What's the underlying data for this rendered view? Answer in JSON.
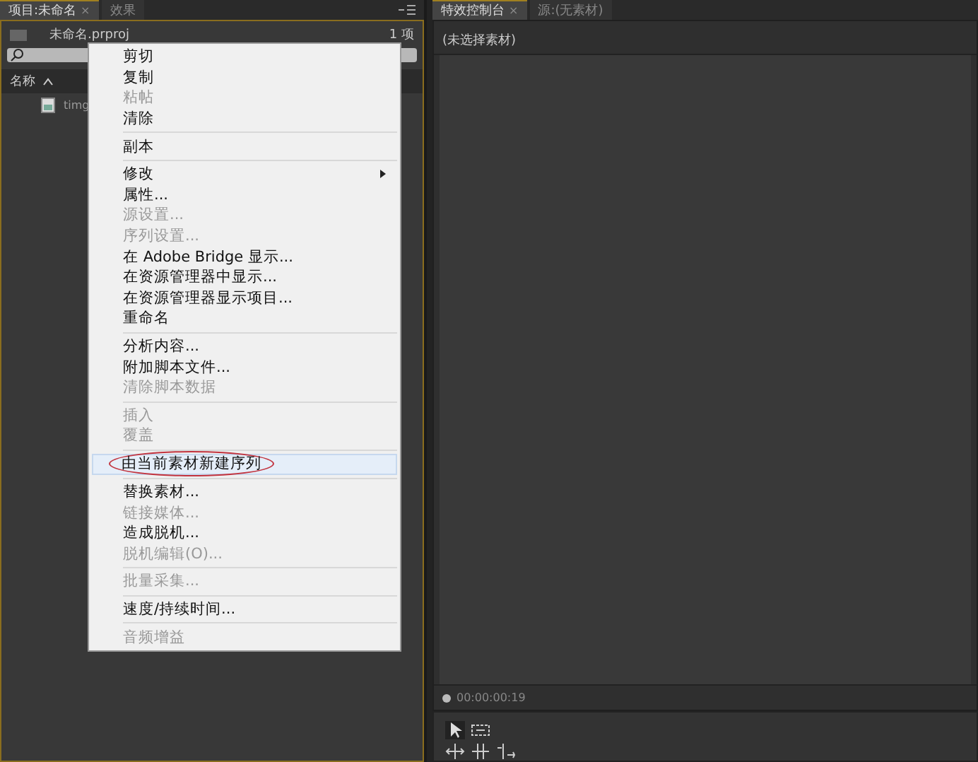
{
  "project_panel": {
    "tabs": [
      {
        "label": "项目:未命名",
        "close_glyph": "×",
        "selected": true
      },
      {
        "label": "效果",
        "selected": false
      }
    ],
    "file_name": "未命名.prproj",
    "item_count": "1 项",
    "column": "名称",
    "files": [
      {
        "name": "timg"
      }
    ]
  },
  "context_menu": {
    "groups": [
      {
        "items": [
          {
            "label": "剪切",
            "disabled": false
          },
          {
            "label": "复制",
            "disabled": false
          },
          {
            "label": "粘帖",
            "disabled": true
          },
          {
            "label": "清除",
            "disabled": false
          }
        ]
      },
      {
        "items": [
          {
            "label": "副本",
            "disabled": false
          }
        ]
      },
      {
        "items": [
          {
            "label": "修改",
            "disabled": false,
            "submenu": true
          },
          {
            "label": "属性...",
            "disabled": false
          },
          {
            "label": "源设置...",
            "disabled": true
          },
          {
            "label": "序列设置...",
            "disabled": true
          },
          {
            "label": "在 Adobe Bridge 显示...",
            "disabled": false
          },
          {
            "label": "在资源管理器中显示...",
            "disabled": false
          },
          {
            "label": "在资源管理器显示项目...",
            "disabled": false
          },
          {
            "label": "重命名",
            "disabled": false
          }
        ]
      },
      {
        "items": [
          {
            "label": "分析内容...",
            "disabled": false
          },
          {
            "label": "附加脚本文件...",
            "disabled": false
          },
          {
            "label": "清除脚本数据",
            "disabled": true
          }
        ]
      },
      {
        "items": [
          {
            "label": "插入",
            "disabled": true
          },
          {
            "label": "覆盖",
            "disabled": true
          }
        ]
      },
      {
        "items": [
          {
            "label": "由当前素材新建序列",
            "disabled": false,
            "selected": true,
            "circled": true
          }
        ]
      },
      {
        "items": [
          {
            "label": "替换素材...",
            "disabled": false
          },
          {
            "label": "链接媒体...",
            "disabled": true
          },
          {
            "label": "造成脱机...",
            "disabled": false
          },
          {
            "label": "脱机编辑(O)...",
            "disabled": true
          }
        ]
      },
      {
        "items": [
          {
            "label": "批量采集...",
            "disabled": true
          }
        ]
      },
      {
        "items": [
          {
            "label": "速度/持续时间...",
            "disabled": false
          }
        ]
      },
      {
        "items": [
          {
            "label": "音频增益",
            "disabled": true
          }
        ]
      }
    ]
  },
  "effects_panel": {
    "tabs": [
      {
        "label": "特效控制台",
        "close_glyph": "×",
        "selected": true
      },
      {
        "label": "源:(无素材)",
        "selected": false
      }
    ],
    "status": "(未选择素材)",
    "timecode": "00:00:00:19"
  }
}
